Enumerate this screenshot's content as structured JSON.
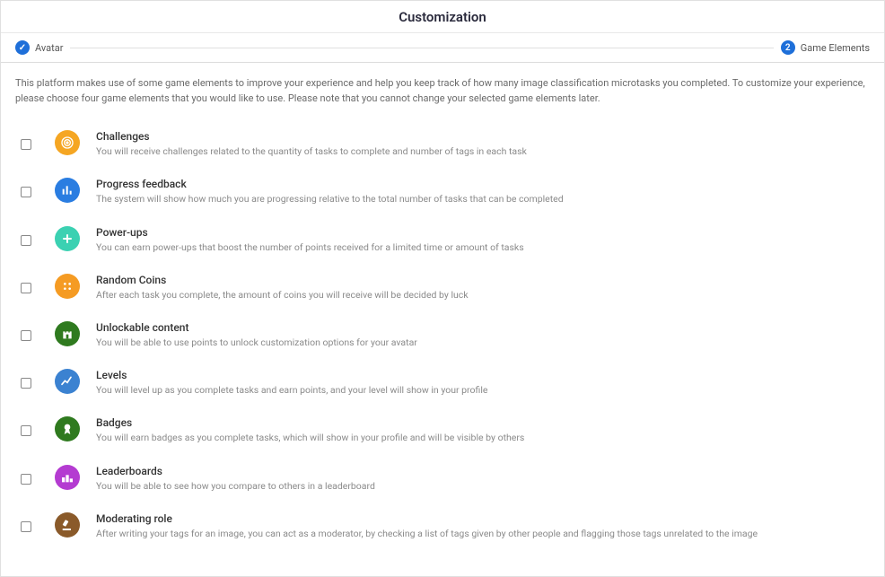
{
  "header": {
    "title": "Customization"
  },
  "stepper": {
    "step1": {
      "label": "Avatar",
      "badge": "✓"
    },
    "step2": {
      "label": "Game Elements",
      "badge": "2"
    }
  },
  "intro_text": "This platform makes use of some game elements to improve your experience and help you keep track of how many image classification microtasks you completed. To customize your experience, please choose four game elements that you would like to use. Please note that you cannot change your selected game elements later.",
  "options": [
    {
      "key": "challenges",
      "title": "Challenges",
      "desc": "You will receive challenges related to the quantity of tasks to complete and number of tags in each task",
      "icon": "target-icon",
      "icon_class": "ic-challenges"
    },
    {
      "key": "progress",
      "title": "Progress feedback",
      "desc": "The system will show how much you are progressing relative to the total number of tasks that can be completed",
      "icon": "bar-chart-icon",
      "icon_class": "ic-progress"
    },
    {
      "key": "powerups",
      "title": "Power-ups",
      "desc": "You can earn power-ups that boost the number of points received for a limited time or amount of tasks",
      "icon": "plus-heart-icon",
      "icon_class": "ic-powerups"
    },
    {
      "key": "random",
      "title": "Random Coins",
      "desc": "After each task you complete, the amount of coins you will receive will be decided by luck",
      "icon": "dice-icon",
      "icon_class": "ic-random"
    },
    {
      "key": "unlockable",
      "title": "Unlockable content",
      "desc": "You will be able to use points to unlock customization options for your avatar",
      "icon": "castle-icon",
      "icon_class": "ic-unlockable"
    },
    {
      "key": "levels",
      "title": "Levels",
      "desc": "You will level up as you complete tasks and earn points, and your level will show in your profile",
      "icon": "trend-icon",
      "icon_class": "ic-levels"
    },
    {
      "key": "badges",
      "title": "Badges",
      "desc": "You will earn badges as you complete tasks, which will show in your profile and will be visible by others",
      "icon": "ribbon-icon",
      "icon_class": "ic-badges"
    },
    {
      "key": "leaderboards",
      "title": "Leaderboards",
      "desc": "You will be able to see how you compare to others in a leaderboard",
      "icon": "podium-icon",
      "icon_class": "ic-leaderboards"
    },
    {
      "key": "moderating",
      "title": "Moderating role",
      "desc": "After writing your tags for an image, you can act as a moderator, by checking a list of tags given by other people and flagging those tags unrelated to the image",
      "icon": "gavel-icon",
      "icon_class": "ic-moderating"
    }
  ]
}
